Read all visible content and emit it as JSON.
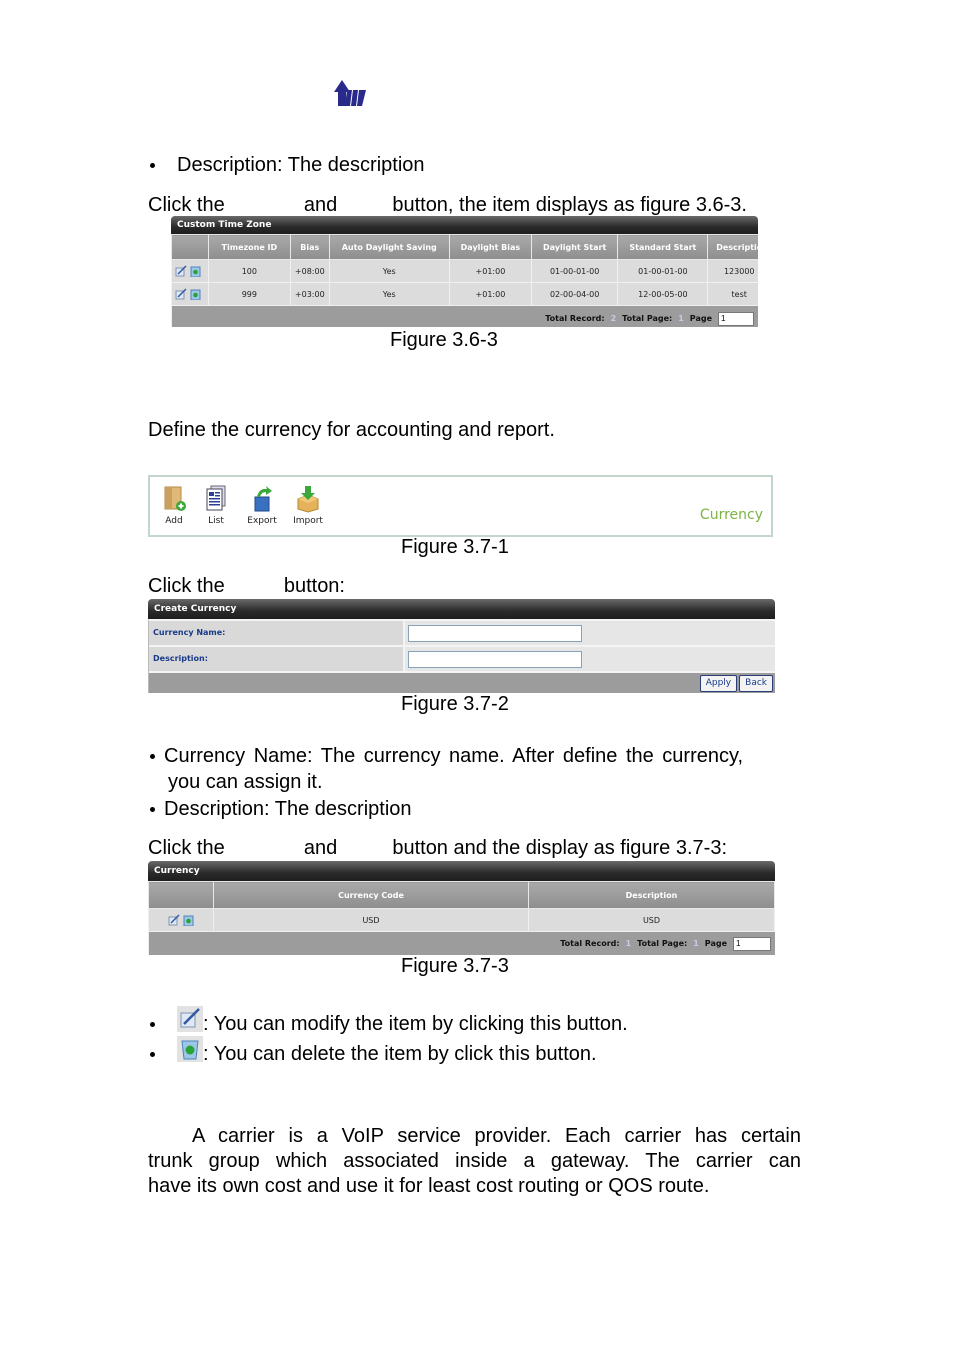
{
  "logo": {
    "icon": "company-logo-arrow-icon"
  },
  "section_36": {
    "bullet": "Description: The description",
    "click_line": {
      "part1": "Click the",
      "part2": "and",
      "part3": "button, the item displays as figure 3.6-3."
    },
    "figure": {
      "title": "Custom Time Zone",
      "columns": [
        "",
        "Timezone ID",
        "Bias",
        "Auto Daylight Saving",
        "Daylight Bias",
        "Daylight Start",
        "Standard Start",
        "Descriptio"
      ],
      "rows": [
        [
          "100",
          "+08:00",
          "Yes",
          "+01:00",
          "01-00-01-00",
          "01-00-01-00",
          "123000"
        ],
        [
          "999",
          "+03:00",
          "Yes",
          "+01:00",
          "02-00-04-00",
          "12-00-05-00",
          "test"
        ]
      ],
      "footer": {
        "total_record_label": "Total Record:",
        "total_record": "2",
        "total_page_label": "Total Page:",
        "total_page": "1",
        "page_label": "Page",
        "page_value": "1"
      },
      "caption": "Figure 3.6-3"
    }
  },
  "section_37": {
    "intro": "Define the currency for accounting and report.",
    "toolbar": {
      "items": [
        {
          "label": "Add",
          "icon": "add-folder-icon"
        },
        {
          "label": "List",
          "icon": "list-document-icon"
        },
        {
          "label": "Export",
          "icon": "export-icon"
        },
        {
          "label": "Import",
          "icon": "import-icon"
        }
      ],
      "title": "Currency",
      "title_color": "#7cb342",
      "caption": "Figure 3.7-1"
    },
    "click_add": {
      "part1": "Click the",
      "part2": "button:"
    },
    "form": {
      "title": "Create Currency",
      "fields": [
        {
          "label": "Currency Name:",
          "value": ""
        },
        {
          "label": "Description:",
          "value": ""
        }
      ],
      "apply_label": "Apply",
      "back_label": "Back",
      "caption": "Figure 3.7-2"
    },
    "bullets": [
      {
        "line1": "Currency Name: The currency name. After define the currency,",
        "line2": "you can assign it."
      },
      {
        "line1": "Description: The description"
      }
    ],
    "click_line": {
      "part1": "Click the",
      "part2": "and",
      "part3": "button and the display as figure 3.7-3:"
    },
    "list": {
      "title": "Currency",
      "columns": [
        "",
        "Currency Code",
        "Description"
      ],
      "rows": [
        [
          "USD",
          "USD"
        ]
      ],
      "footer": {
        "total_record_label": "Total Record:",
        "total_record": "1",
        "total_page_label": "Total Page:",
        "total_page": "1",
        "page_label": "Page",
        "page_value": "1"
      },
      "caption": "Figure 3.7-3"
    },
    "icon_notes": [
      {
        "icon": "edit-icon",
        "text": ": You can modify the item by clicking this button."
      },
      {
        "icon": "delete-icon",
        "text": ": You can delete the item by click this button."
      }
    ]
  },
  "section_38": {
    "lines": [
      "A carrier is a VoIP service provider. Each carrier has certain",
      "trunk group which associated inside a gateway. The carrier can",
      "have its own cost and use it for least cost routing or QOS route."
    ]
  }
}
